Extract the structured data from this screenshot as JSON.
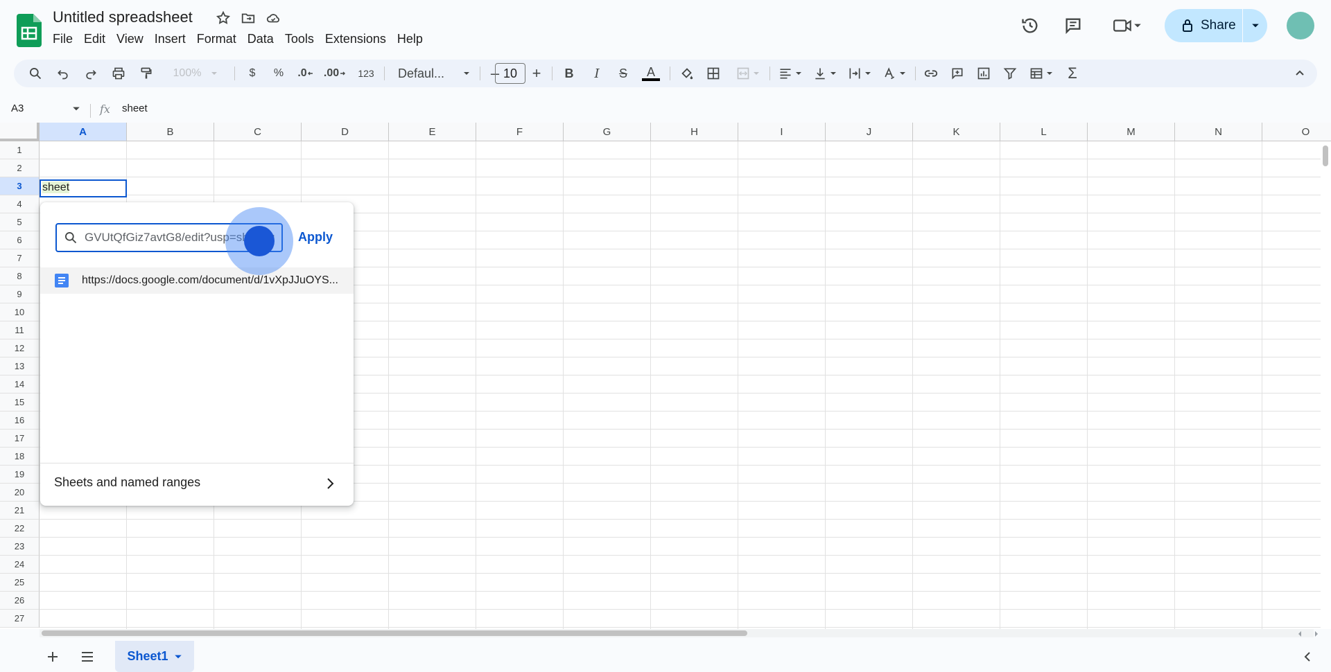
{
  "app": {
    "title": "Untitled spreadsheet",
    "menu": [
      "File",
      "Edit",
      "View",
      "Insert",
      "Format",
      "Data",
      "Tools",
      "Extensions",
      "Help"
    ],
    "share_label": "Share"
  },
  "toolbar": {
    "zoom": "100%",
    "currency": "$",
    "percent": "%",
    "dec_decrease": ".0",
    "dec_increase": ".00",
    "number_format": "123",
    "font": "Defaul...",
    "font_size": "10",
    "minus": "–",
    "plus": "+",
    "bold": "B",
    "italic": "I",
    "strike": "S",
    "text_color": "A",
    "sigma": "Σ"
  },
  "formula_bar": {
    "name_box": "A3",
    "fx": "fx",
    "content": "sheet"
  },
  "grid": {
    "columns": [
      "A",
      "B",
      "C",
      "D",
      "E",
      "F",
      "G",
      "H",
      "I",
      "J",
      "K",
      "L",
      "M",
      "N",
      "O"
    ],
    "rows": [
      "1",
      "2",
      "3",
      "4",
      "5",
      "6",
      "7",
      "8",
      "9",
      "10",
      "11",
      "12",
      "13",
      "14",
      "15",
      "16",
      "17",
      "18",
      "19",
      "20",
      "21",
      "22",
      "23",
      "24",
      "25",
      "26",
      "27"
    ],
    "selected_column": "A",
    "selected_row": "3",
    "active_cell_value": "sheet"
  },
  "link_popup": {
    "input_value": "GVUtQfGiz7avtG8/edit?usp=sharing",
    "apply_label": "Apply",
    "suggestion": "https://docs.google.com/document/d/1vXpJJuOYS...",
    "sheets_named_ranges": "Sheets and named ranges"
  },
  "bottom": {
    "sheet_tab": "Sheet1"
  },
  "colors": {
    "accent": "#0b57d0",
    "share_bg": "#c2e7ff",
    "sheets_green": "#0f9d58"
  }
}
